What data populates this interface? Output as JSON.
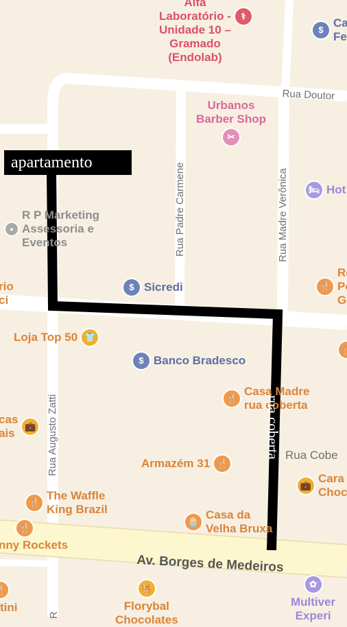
{
  "colors": {
    "background": "#f7efe2",
    "road": "#ffffff",
    "avenue": "#fdf7cf",
    "route": "#000000",
    "pin_red": "#e05b66",
    "pin_blue": "#6d82b8",
    "pin_orange": "#f0994a",
    "pin_pink": "#e28fb8",
    "pin_purple": "#a79ae0",
    "pin_gray": "#a9a9a9",
    "text_red": "#d9516a",
    "text_blue": "#5c6fa4",
    "text_orange": "#d9853a",
    "text_pink": "#d9689b",
    "text_purple": "#9b87d8",
    "text_gray": "#8e8e8e"
  },
  "annotations": {
    "start_label": "apartamento",
    "covered_street_label": "rua coberta"
  },
  "streets": {
    "rua_doutor": "Rua Doutor",
    "rua_padre_carmene": "Rua Padre Carmene",
    "rua_madre_veronica": "Rua Madre Verônica",
    "rua_augusto_zatti": "Rua Augusto Zatti",
    "rua_coberta": "Rua Cobe",
    "av_borges": "Av. Borges de Medeiros",
    "r_cut": "R"
  },
  "pois": {
    "laboratorio": {
      "name": "Alfa\nLaboratório -\nUnidade 10 –\nGramado\n(Endolab)",
      "icon": "stethoscope-icon",
      "glyph": "⚕"
    },
    "cafe_top_right": {
      "name": "Ca\nFe",
      "icon": "bank-icon",
      "glyph": "$"
    },
    "urbanos": {
      "name": "Urbanos\nBarber Shop",
      "icon": "scissors-icon",
      "glyph": "✂"
    },
    "hotel": {
      "name": "Hot",
      "icon": "bed-icon",
      "glyph": "🛏"
    },
    "rp_marketing": {
      "name": "R P Marketing\nAssessoria e\nEventos",
      "icon": "pin-dot-icon",
      "glyph": "●"
    },
    "sicredi": {
      "name": "Sicredi",
      "icon": "bank-icon",
      "glyph": "$"
    },
    "left_rio": {
      "name": "rio\nci",
      "icon": "",
      "glyph": ""
    },
    "right_rpg": {
      "name": "Re\nPo\nGr",
      "icon": "fork-knife-icon",
      "glyph": "🍴"
    },
    "loja_top_50": {
      "name": "Loja Top 50",
      "icon": "shirt-icon",
      "glyph": "👕"
    },
    "bradesco": {
      "name": "Banco Bradesco",
      "icon": "bank-icon",
      "glyph": "$"
    },
    "right_food_cut": {
      "name": "",
      "icon": "fork-knife-icon",
      "glyph": "🍴"
    },
    "casa_madre": {
      "name": "Casa Madre\nrua coberta",
      "icon": "fork-knife-icon",
      "glyph": "🍴"
    },
    "left_cas": {
      "name": "cas\nais",
      "icon": "briefcase-icon",
      "glyph": "💼"
    },
    "armazem": {
      "name": "Armazém 31",
      "icon": "fork-knife-icon",
      "glyph": "🍴"
    },
    "cara_choc": {
      "name": "Cara\nChoc",
      "icon": "briefcase-icon",
      "glyph": "💼"
    },
    "waffle_king": {
      "name": "The Waffle\nKing Brazil",
      "icon": "fork-knife-icon",
      "glyph": "🍴"
    },
    "waffle_icon2": {
      "name": "",
      "icon": "fork-knife-icon",
      "glyph": "🍴"
    },
    "casa_velha": {
      "name": "Casa da\nVelha Bruxa",
      "icon": "cupcake-icon",
      "glyph": "🧁"
    },
    "johnny_rockets": {
      "name": "nny Rockets",
      "icon": "",
      "glyph": ""
    },
    "florybal": {
      "name": "Florybal\nChocolates",
      "icon": "basket-icon",
      "glyph": "🧺"
    },
    "left_tini": {
      "name": "tini",
      "icon": "fork-knife-icon",
      "glyph": "🍴"
    },
    "multiverso": {
      "name": "Multiver\nExperi",
      "icon": "flower-icon",
      "glyph": "✿"
    }
  }
}
